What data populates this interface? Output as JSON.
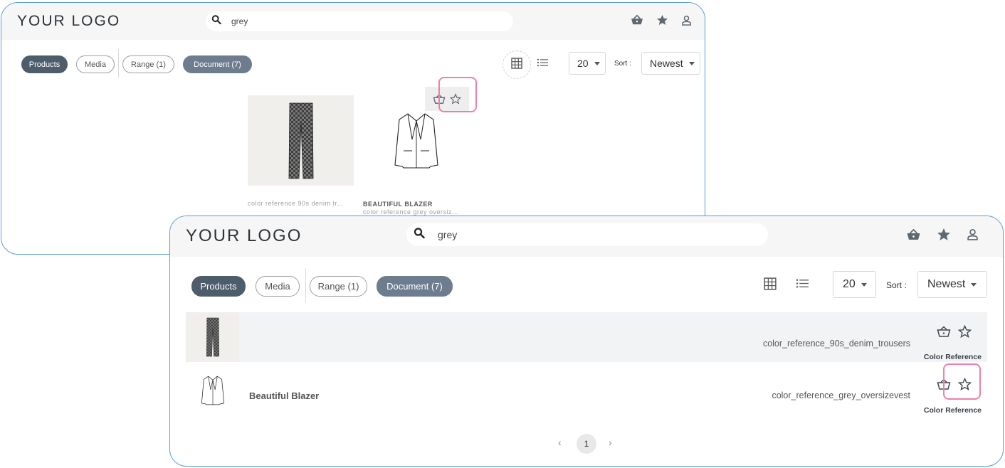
{
  "logo": "YOUR LOGO",
  "search": {
    "value": "grey"
  },
  "header_icons": [
    "basket-icon",
    "star-icon",
    "user-icon"
  ],
  "filters": [
    {
      "label": "Products",
      "state": "active"
    },
    {
      "label": "Media",
      "state": "outline"
    },
    {
      "label": "Range (1)",
      "state": "outline"
    },
    {
      "label": "Document (7)",
      "state": "selected"
    }
  ],
  "per_page": {
    "value": "20"
  },
  "sort": {
    "label": "Sort :",
    "value": "Newest"
  },
  "grid_view": {
    "cards": [
      {
        "title": "",
        "caption": "color reference 90s denim tr..."
      },
      {
        "title": "BEAUTIFUL BLAZER",
        "caption": "color reference grey oversiz..."
      }
    ]
  },
  "list_view": {
    "rows": [
      {
        "title": "",
        "reference": "color_reference_90s_denim_trousers",
        "type": "Color Reference"
      },
      {
        "title": "Beautiful Blazer",
        "reference": "color_reference_grey_oversizevest",
        "type": "Color Reference"
      }
    ]
  },
  "pagination": {
    "prev": "‹",
    "current": "1",
    "next": "›"
  },
  "colors": {
    "accent_dark": "#4d5d6c",
    "accent_mid": "#6d7d8e",
    "highlight": "#f07fa8",
    "window_border": "#5b9bd5"
  }
}
